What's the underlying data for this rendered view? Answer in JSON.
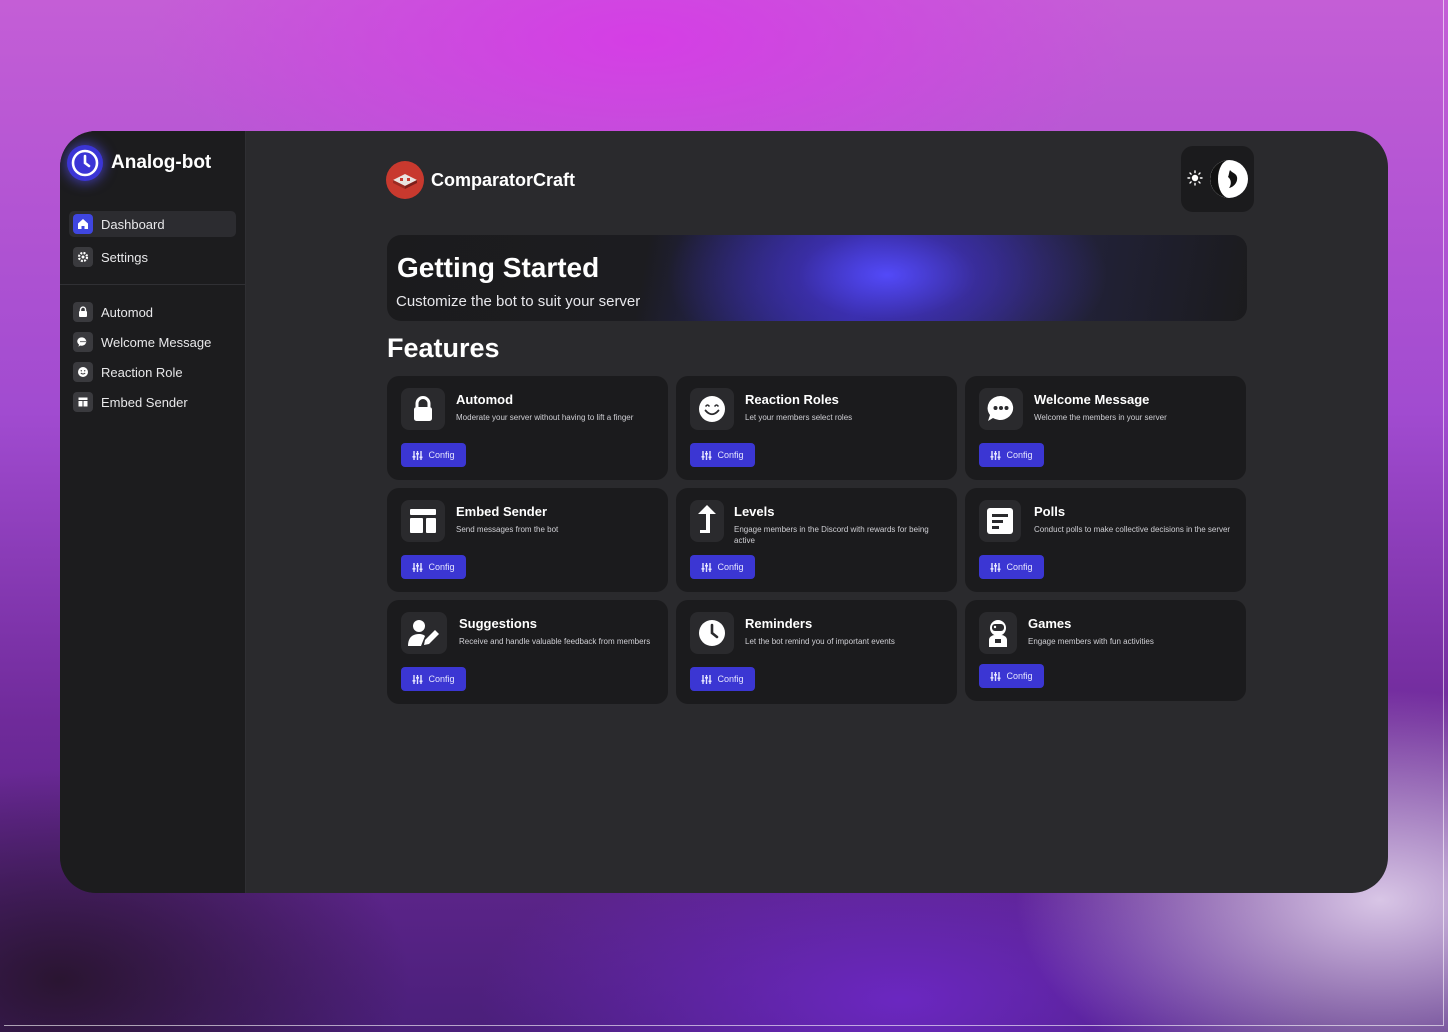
{
  "app": {
    "name": "Analog-bot"
  },
  "sidebar": {
    "top_items": [
      {
        "label": "Dashboard",
        "icon": "home-icon",
        "active": true
      },
      {
        "label": "Settings",
        "icon": "gear-icon",
        "active": false
      }
    ],
    "feature_items": [
      {
        "label": "Automod",
        "icon": "lock-icon"
      },
      {
        "label": "Welcome Message",
        "icon": "chat-bubble-icon"
      },
      {
        "label": "Reaction Role",
        "icon": "smiley-icon"
      },
      {
        "label": "Embed Sender",
        "icon": "layout-icon"
      }
    ]
  },
  "header": {
    "server_name": "ComparatorCraft"
  },
  "banner": {
    "title": "Getting Started",
    "subtitle": "Customize the bot to suit your server"
  },
  "features": {
    "title": "Features",
    "config_label": "Config",
    "cards": [
      {
        "name": "Automod",
        "description": "Moderate your server without  having to lift a finger",
        "icon": "lock-icon"
      },
      {
        "name": "Reaction Roles",
        "description": "Let your members select roles",
        "icon": "smiley-icon"
      },
      {
        "name": "Welcome Message",
        "description": "Welcome the members in your server",
        "icon": "chat-bubble-icon"
      },
      {
        "name": "Embed Sender",
        "description": "Send messages from the bot",
        "icon": "layout-icon"
      },
      {
        "name": "Levels",
        "description": "Engage members in the Discord with rewards for being active",
        "icon": "arrow-up-icon"
      },
      {
        "name": "Polls",
        "description": "Conduct polls to make collective decisions in the server",
        "icon": "poll-icon"
      },
      {
        "name": "Suggestions",
        "description": "Receive and handle valuable feedback from members",
        "icon": "user-edit-icon"
      },
      {
        "name": "Reminders",
        "description": "Let the bot remind you of important events",
        "icon": "clock-icon"
      },
      {
        "name": "Games",
        "description": "Engage members with fun activities",
        "icon": "astronaut-icon"
      }
    ]
  },
  "colors": {
    "accent": "#3b36d3",
    "window_bg": "#2a2a2d",
    "sidebar_bg": "#1c1c1e",
    "card_bg": "#1b1b1d",
    "server_icon": "#c8392e"
  }
}
